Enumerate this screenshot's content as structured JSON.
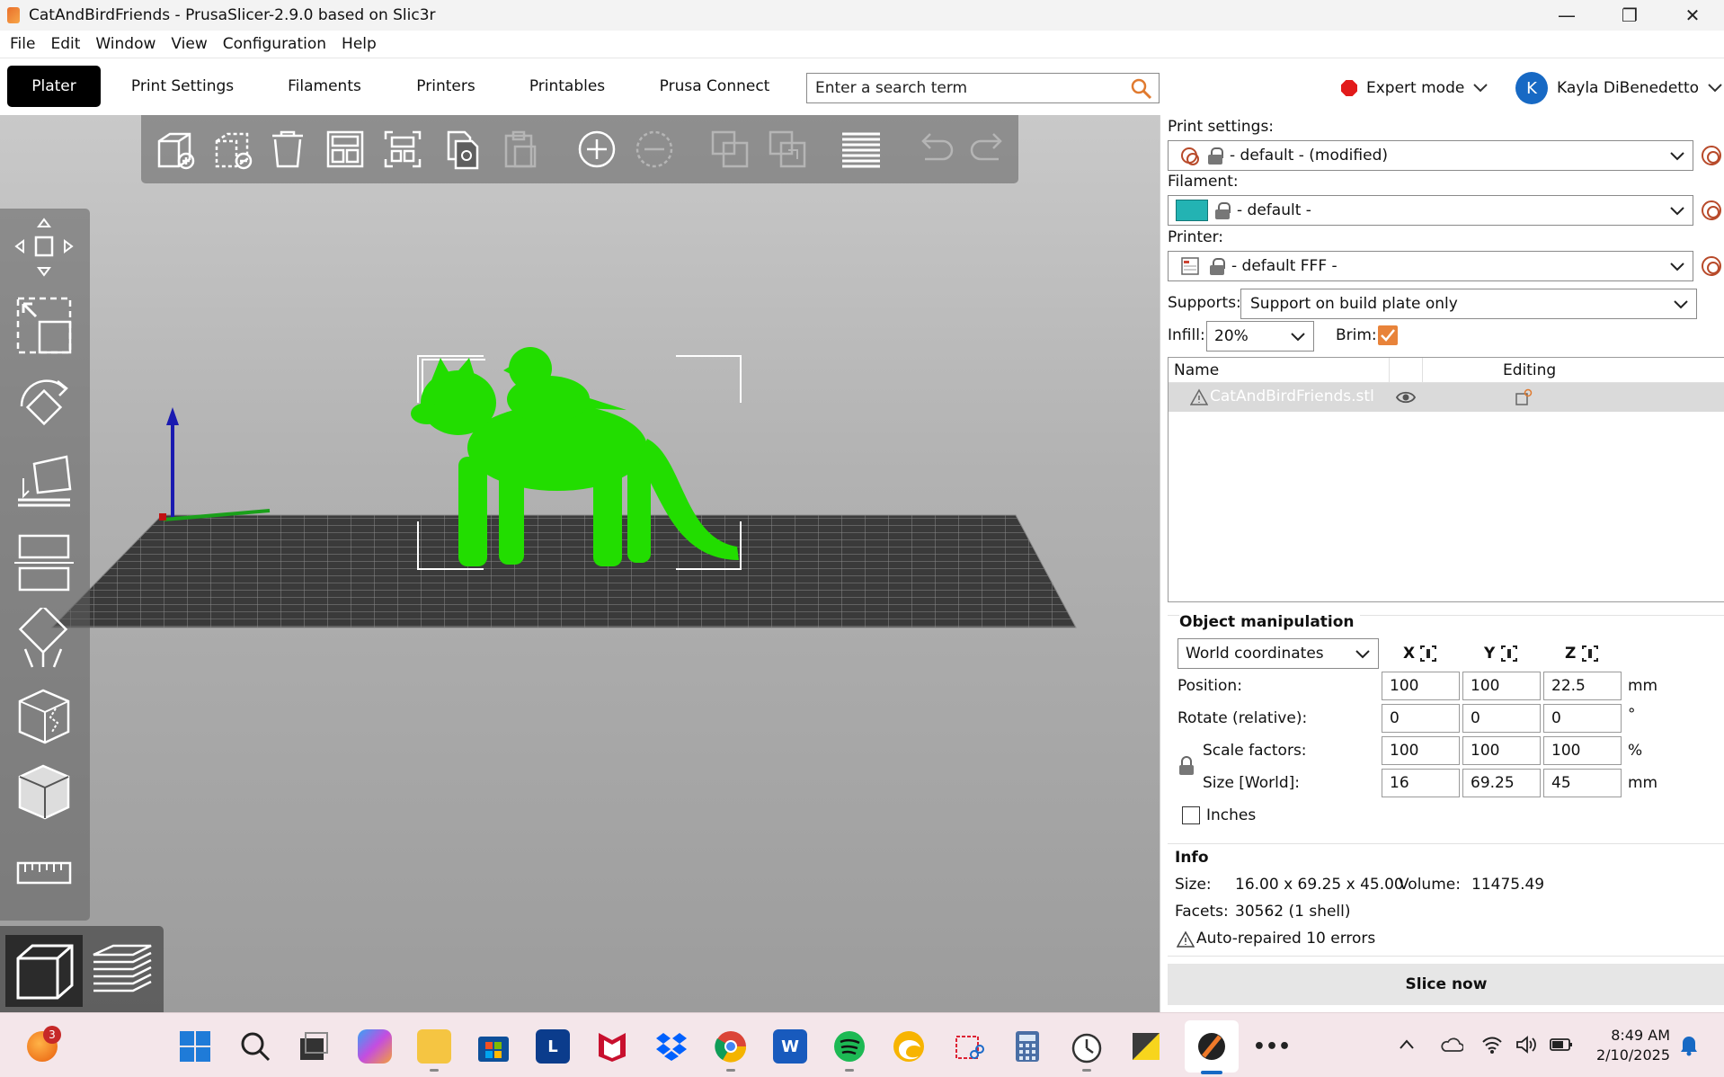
{
  "window": {
    "title": "CatAndBirdFriends - PrusaSlicer-2.9.0 based on Slic3r",
    "minimize": "—",
    "maximize": "❐",
    "close": "✕"
  },
  "menu": [
    "File",
    "Edit",
    "Window",
    "View",
    "Configuration",
    "Help"
  ],
  "tabs": [
    "Plater",
    "Print Settings",
    "Filaments",
    "Printers",
    "Printables",
    "Prusa Connect"
  ],
  "search": {
    "placeholder": "Enter a search term"
  },
  "mode": {
    "label": "Expert mode",
    "color": "#e21b1b"
  },
  "user": {
    "initial": "K",
    "name": "Kayla DiBenedetto"
  },
  "settings": {
    "print_label": "Print settings:",
    "print_value": "- default - (modified)",
    "filament_label": "Filament:",
    "filament_value": "- default -",
    "filament_color": "#23b3b3",
    "printer_label": "Printer:",
    "printer_value": "- default FFF -",
    "supports_label": "Supports:",
    "supports_value": "Support on build plate only",
    "infill_label": "Infill:",
    "infill_value": "20%",
    "brim_label": "Brim:",
    "brim_checked": true
  },
  "object_list": {
    "col_name": "Name",
    "col_editing": "Editing",
    "rows": [
      {
        "name": "CatAndBirdFriends.stl",
        "warning": true
      }
    ]
  },
  "manipulation": {
    "title": "Object manipulation",
    "coord_system": "World coordinates",
    "axes": [
      "X",
      "Y",
      "Z"
    ],
    "position_label": "Position:",
    "position": [
      "100",
      "100",
      "22.5"
    ],
    "position_unit": "mm",
    "rotate_label": "Rotate (relative):",
    "rotate": [
      "0",
      "0",
      "0"
    ],
    "rotate_unit": "°",
    "scale_label": "Scale factors:",
    "scale": [
      "100",
      "100",
      "100"
    ],
    "scale_unit": "%",
    "size_label": "Size [World]:",
    "size": [
      "16",
      "69.25",
      "45"
    ],
    "size_unit": "mm",
    "inches_label": "Inches"
  },
  "info": {
    "title": "Info",
    "size_label": "Size:",
    "size_value": "16.00 x 69.25 x 45.00",
    "volume_label": "Volume:",
    "volume_value": "11475.49",
    "facets_label": "Facets:",
    "facets_value": "30562 (1 shell)",
    "repair_text": "Auto-repaired 10 errors"
  },
  "slice_button": "Slice now",
  "model_color": "#22dd00",
  "taskbar": {
    "notification_badge": "3",
    "time": "8:49 AM",
    "date": "2/10/2025",
    "apps": [
      "start",
      "search",
      "task-view",
      "copilot",
      "file-explorer",
      "store",
      "lexis",
      "mcafee",
      "dropbox",
      "chrome",
      "word",
      "spotify",
      "edge-canary",
      "snipping",
      "calculator",
      "clock",
      "sticky",
      "prusaslicer",
      "more"
    ]
  }
}
